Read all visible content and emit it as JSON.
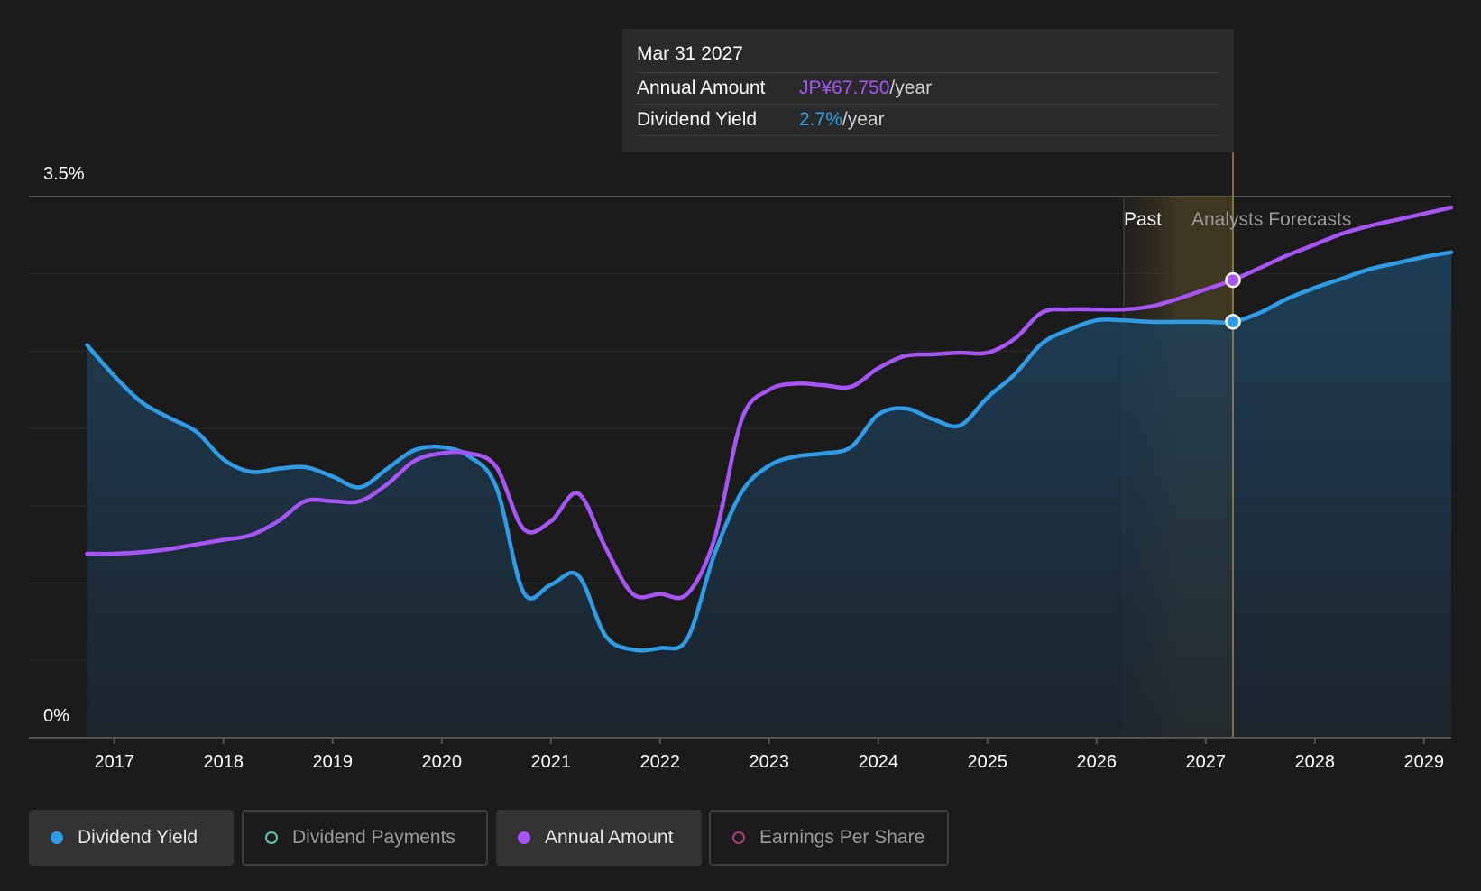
{
  "chart_data": {
    "type": "line",
    "y_axis": {
      "top_label": "3.5%",
      "bottom_label": "0%",
      "ylim": [
        0,
        3.5
      ]
    },
    "x_ticks": [
      "2017",
      "2018",
      "2019",
      "2020",
      "2021",
      "2022",
      "2023",
      "2024",
      "2025",
      "2026",
      "2027",
      "2028",
      "2029"
    ],
    "xlim": [
      2016.75,
      2029.25
    ],
    "past_label": "Past",
    "forecast_label": "Analysts Forecasts",
    "past_band": [
      2026.25,
      2026.75
    ],
    "forecast_band": [
      2026.75,
      2027.25
    ],
    "cursor_x": 2027.25,
    "series": [
      {
        "name": "Dividend Yield",
        "color": "#2f9ce8",
        "points": [
          [
            2016.75,
            2.54
          ],
          [
            2017.0,
            2.34
          ],
          [
            2017.25,
            2.17
          ],
          [
            2017.5,
            2.07
          ],
          [
            2017.75,
            1.98
          ],
          [
            2018.0,
            1.8
          ],
          [
            2018.25,
            1.72
          ],
          [
            2018.5,
            1.74
          ],
          [
            2018.75,
            1.75
          ],
          [
            2019.0,
            1.69
          ],
          [
            2019.25,
            1.62
          ],
          [
            2019.5,
            1.74
          ],
          [
            2019.75,
            1.86
          ],
          [
            2020.0,
            1.88
          ],
          [
            2020.25,
            1.82
          ],
          [
            2020.5,
            1.62
          ],
          [
            2020.75,
            0.94
          ],
          [
            2021.0,
            0.99
          ],
          [
            2021.25,
            1.05
          ],
          [
            2021.5,
            0.66
          ],
          [
            2021.75,
            0.57
          ],
          [
            2022.0,
            0.58
          ],
          [
            2022.25,
            0.64
          ],
          [
            2022.5,
            1.19
          ],
          [
            2022.75,
            1.59
          ],
          [
            2023.0,
            1.76
          ],
          [
            2023.25,
            1.82
          ],
          [
            2023.5,
            1.84
          ],
          [
            2023.75,
            1.88
          ],
          [
            2024.0,
            2.09
          ],
          [
            2024.25,
            2.13
          ],
          [
            2024.5,
            2.06
          ],
          [
            2024.75,
            2.02
          ],
          [
            2025.0,
            2.2
          ],
          [
            2025.25,
            2.35
          ],
          [
            2025.5,
            2.55
          ],
          [
            2025.75,
            2.64
          ],
          [
            2026.0,
            2.7
          ],
          [
            2026.25,
            2.7
          ],
          [
            2026.5,
            2.69
          ],
          [
            2026.75,
            2.69
          ],
          [
            2027.0,
            2.69
          ],
          [
            2027.25,
            2.69
          ],
          [
            2027.5,
            2.75
          ],
          [
            2027.75,
            2.84
          ],
          [
            2028.0,
            2.91
          ],
          [
            2028.25,
            2.97
          ],
          [
            2028.5,
            3.03
          ],
          [
            2028.75,
            3.07
          ],
          [
            2029.0,
            3.11
          ],
          [
            2029.25,
            3.14
          ]
        ]
      },
      {
        "name": "Annual Amount",
        "color": "#a855f7",
        "points": [
          [
            2016.75,
            1.19
          ],
          [
            2017.0,
            1.19
          ],
          [
            2017.25,
            1.2
          ],
          [
            2017.5,
            1.22
          ],
          [
            2017.75,
            1.25
          ],
          [
            2018.0,
            1.28
          ],
          [
            2018.25,
            1.31
          ],
          [
            2018.5,
            1.4
          ],
          [
            2018.75,
            1.53
          ],
          [
            2019.0,
            1.53
          ],
          [
            2019.25,
            1.53
          ],
          [
            2019.5,
            1.64
          ],
          [
            2019.75,
            1.79
          ],
          [
            2020.0,
            1.84
          ],
          [
            2020.25,
            1.84
          ],
          [
            2020.5,
            1.75
          ],
          [
            2020.75,
            1.35
          ],
          [
            2021.0,
            1.4
          ],
          [
            2021.25,
            1.58
          ],
          [
            2021.5,
            1.23
          ],
          [
            2021.75,
            0.93
          ],
          [
            2022.0,
            0.93
          ],
          [
            2022.25,
            0.93
          ],
          [
            2022.5,
            1.29
          ],
          [
            2022.75,
            2.06
          ],
          [
            2023.0,
            2.25
          ],
          [
            2023.25,
            2.29
          ],
          [
            2023.5,
            2.28
          ],
          [
            2023.75,
            2.27
          ],
          [
            2024.0,
            2.39
          ],
          [
            2024.25,
            2.47
          ],
          [
            2024.5,
            2.48
          ],
          [
            2024.75,
            2.49
          ],
          [
            2025.0,
            2.49
          ],
          [
            2025.25,
            2.58
          ],
          [
            2025.5,
            2.75
          ],
          [
            2025.75,
            2.77
          ],
          [
            2026.0,
            2.77
          ],
          [
            2026.25,
            2.77
          ],
          [
            2026.5,
            2.79
          ],
          [
            2026.75,
            2.84
          ],
          [
            2027.0,
            2.9
          ],
          [
            2027.25,
            2.96
          ],
          [
            2027.5,
            3.04
          ],
          [
            2027.75,
            3.12
          ],
          [
            2028.0,
            3.19
          ],
          [
            2028.25,
            3.26
          ],
          [
            2028.5,
            3.31
          ],
          [
            2028.75,
            3.35
          ],
          [
            2029.0,
            3.39
          ],
          [
            2029.25,
            3.43
          ]
        ]
      }
    ]
  },
  "tooltip": {
    "date": "Mar 31 2027",
    "rows": [
      {
        "label": "Annual Amount",
        "value": "JP¥67.750",
        "unit": "/year"
      },
      {
        "label": "Dividend Yield",
        "value": "2.7%",
        "unit": "/year"
      }
    ]
  },
  "legend": [
    {
      "label": "Dividend Yield",
      "color": "#2f9ce8",
      "active": true
    },
    {
      "label": "Dividend Payments",
      "color": "#5cc7b0",
      "active": false
    },
    {
      "label": "Annual Amount",
      "color": "#a855f7",
      "active": true
    },
    {
      "label": "Earnings Per Share",
      "color": "#b03a7a",
      "active": false
    }
  ]
}
